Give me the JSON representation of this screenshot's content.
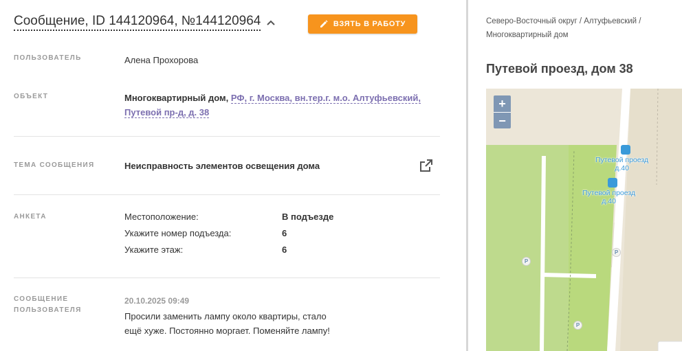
{
  "header": {
    "title": "Сообщение, ID 144120964, №144120964",
    "take_button": "ВЗЯТЬ В РАБОТУ"
  },
  "fields": {
    "user_label": "ПОЛЬЗОВАТЕЛЬ",
    "user_value": "Алена Прохорова",
    "object_label": "ОБЪЕКТ",
    "object_type": "Многоквартирный дом,",
    "object_address_line1": "РФ, г. Москва, вн.тер.г. м.о. Алтуфьевский,",
    "object_address_line2": "Путевой пр-д, д. 38",
    "topic_label": "ТЕМА СООБЩЕНИЯ",
    "topic_value": "Неисправность элементов освещения дома",
    "form_label": "АНКЕТА",
    "message_label_line1": "СООБЩЕНИЕ",
    "message_label_line2": "ПОЛЬЗОВАТЕЛЯ"
  },
  "questionnaire": [
    {
      "question": "Местоположение:",
      "answer": "В подъезде"
    },
    {
      "question": "Укажите номер подъезда:",
      "answer": "6"
    },
    {
      "question": "Укажите этаж:",
      "answer": "6"
    }
  ],
  "message": {
    "date": "20.10.2025 09:49",
    "text_line1": "Просили заменить лампу около квартиры, стало",
    "text_line2": "ещё хуже. Постоянно моргает. Поменяйте лампу!"
  },
  "right_panel": {
    "breadcrumb_line1": "Северо-Восточный округ / Алтуфьевский /",
    "breadcrumb_line2": "Многоквартирный дом",
    "address_title": "Путевой проезд, дом 38"
  },
  "map": {
    "zoom_in": "+",
    "zoom_out": "−",
    "stop1_line1": "Путевой проезд",
    "stop1_line2": "д.40",
    "stop2_line1": "Путевой проезд",
    "stop2_line2": "д.40",
    "parking": "P"
  },
  "colors": {
    "accent": "#f7941d",
    "link": "#7c6fb0",
    "map_zoom": "#7f97b4",
    "park_green": "#b9d97d"
  }
}
